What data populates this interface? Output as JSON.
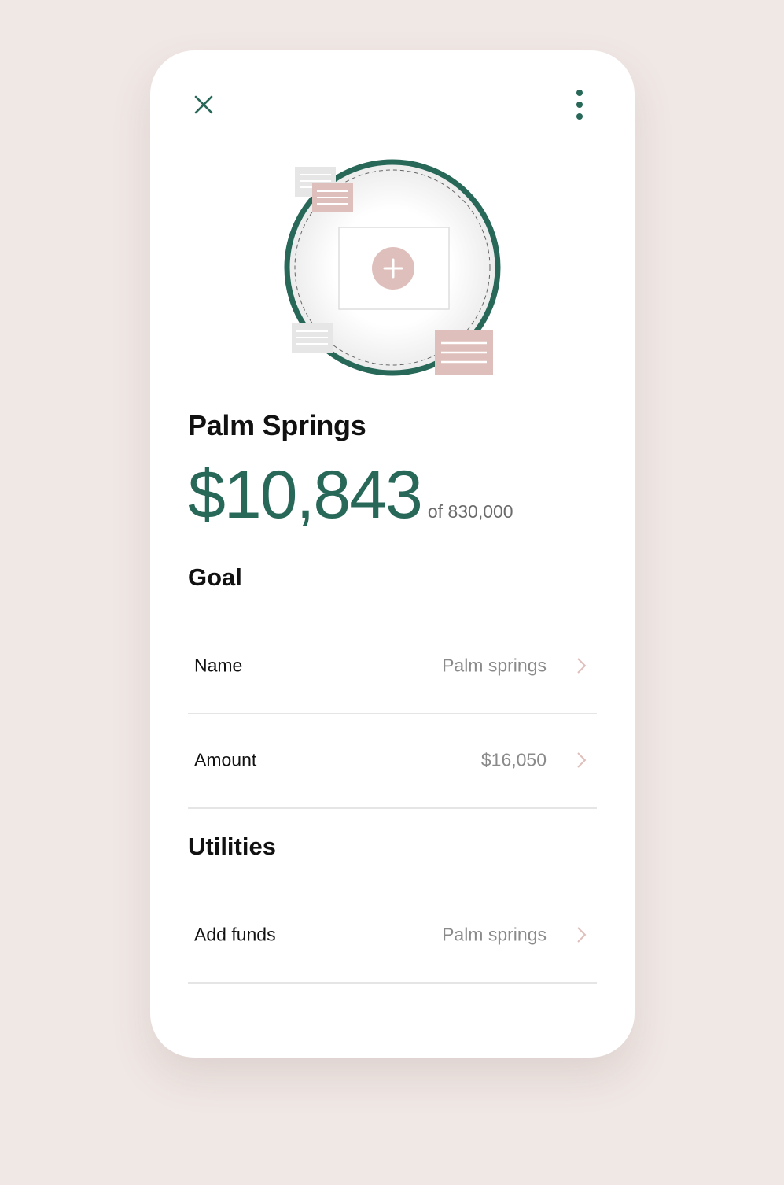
{
  "header": {
    "close_icon": "close-icon",
    "more_icon": "more-vertical-icon"
  },
  "colors": {
    "accent": "#276858",
    "pink": "#dfbfbb",
    "background": "#f0e8e5"
  },
  "goal_summary": {
    "title": "Palm Springs",
    "amount": "$10,843",
    "of_total": "of 830,000"
  },
  "sections": {
    "goal": {
      "title": "Goal",
      "rows": [
        {
          "label": "Name",
          "value": "Palm springs"
        },
        {
          "label": "Amount",
          "value": "$16,050"
        }
      ]
    },
    "utilities": {
      "title": "Utilities",
      "rows": [
        {
          "label": "Add funds",
          "value": "Palm springs"
        }
      ]
    }
  }
}
